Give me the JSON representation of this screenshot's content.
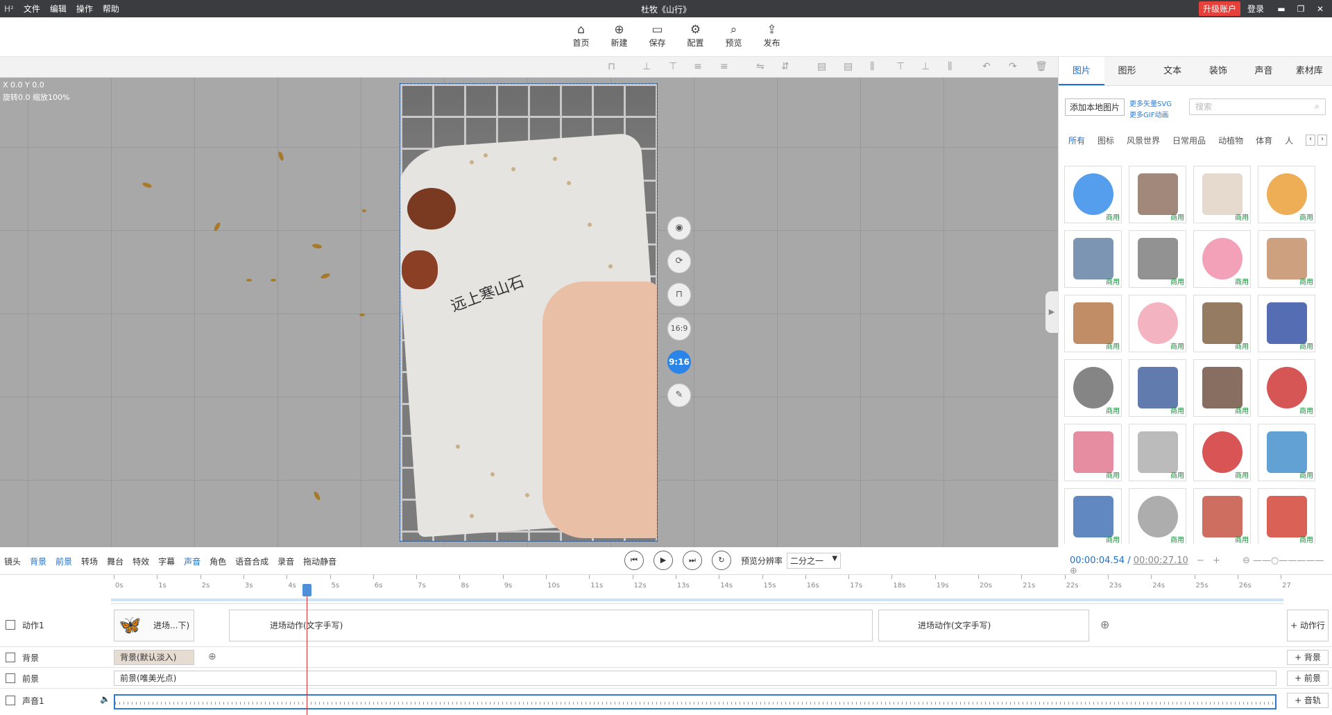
{
  "titlebar": {
    "logo": "H²",
    "menu": [
      "文件",
      "编辑",
      "操作",
      "帮助"
    ],
    "title": "杜牧《山行》",
    "upgrade": "升级账户",
    "login": "登录",
    "min": "▬",
    "max": "❐",
    "close": "✕"
  },
  "toolbar": {
    "items": [
      {
        "label": "首页",
        "icon": "home-icon",
        "glyph": "⌂"
      },
      {
        "label": "新建",
        "icon": "new-file-icon",
        "glyph": "⊕"
      },
      {
        "label": "保存",
        "icon": "save-icon",
        "glyph": "▭"
      },
      {
        "label": "配置",
        "icon": "settings-icon",
        "glyph": "⚙"
      },
      {
        "label": "预览",
        "icon": "preview-icon",
        "glyph": "⌕"
      },
      {
        "label": "发布",
        "icon": "publish-icon",
        "glyph": "⇪"
      }
    ]
  },
  "canvas": {
    "coord_line1": "X 0.0 Y 0.0",
    "coord_line2": "旋转0.0 缩放100%",
    "handwriting": "远上寒山石",
    "side_buttons": [
      {
        "name": "screenshot-icon",
        "label": "◉"
      },
      {
        "name": "rotate-icon",
        "label": "⟳"
      },
      {
        "name": "lock-icon",
        "label": "⊓"
      },
      {
        "name": "ratio-16-9-button",
        "label": "16:9"
      },
      {
        "name": "ratio-9-16-button",
        "label": "9:16"
      },
      {
        "name": "edit-icon",
        "label": "✎"
      }
    ]
  },
  "rpanel": {
    "tabs": [
      "图片",
      "图形",
      "文本",
      "装饰",
      "声音",
      "素材库"
    ],
    "add_local": "添加本地图片",
    "more_svg": "更多矢量SVG",
    "more_gif": "更多GIF动画",
    "search_placeholder": "搜索",
    "categories": [
      "所有",
      "图标",
      "风景世界",
      "日常用品",
      "动植物",
      "体育",
      "人"
    ],
    "commercial_tag": "商用",
    "items": [
      "blue-moon",
      "building",
      "paper-cup",
      "tiger",
      "people-meeting",
      "texture-tile",
      "medical-box",
      "man-standing",
      "worker",
      "people-pink",
      "basket",
      "pen",
      "line-chart",
      "man-blue",
      "boy-standing",
      "red-button",
      "arrow",
      "van",
      "superhero",
      "computer",
      "man-surprised",
      "cat-pink",
      "man-pointing",
      "umbrella"
    ]
  },
  "timeline": {
    "tools": [
      "镜头",
      "背景",
      "前景",
      "转场",
      "舞台",
      "特效",
      "字幕",
      "声音",
      "角色",
      "语音合成",
      "录音",
      "拖动静音"
    ],
    "resolution_label": "预览分辨率",
    "resolution_value": "二分之一",
    "current_time": "00:00:04.54",
    "total_time": "00:00:27.10",
    "ticks": [
      "0s",
      "1s",
      "2s",
      "3s",
      "4s",
      "5s",
      "6s",
      "7s",
      "8s",
      "9s",
      "10s",
      "11s",
      "12s",
      "13s",
      "14s",
      "15s",
      "16s",
      "17s",
      "18s",
      "19s",
      "20s",
      "21s",
      "22s",
      "23s",
      "24s",
      "25s",
      "26s",
      "27"
    ],
    "tracks": {
      "action": {
        "label": "动作1",
        "clip1": "进场...下)",
        "clip2": "进场动作(文字手写)",
        "clip3": "进场动作(文字手写)",
        "add": "+ 动作行"
      },
      "background": {
        "label": "背景",
        "clip": "背景(默认淡入)",
        "add": "+ 背景"
      },
      "foreground": {
        "label": "前景",
        "clip": "前景(唯美光点)",
        "add": "+ 前景"
      },
      "audio": {
        "label": "声音1",
        "add": "+ 音轨"
      }
    }
  }
}
